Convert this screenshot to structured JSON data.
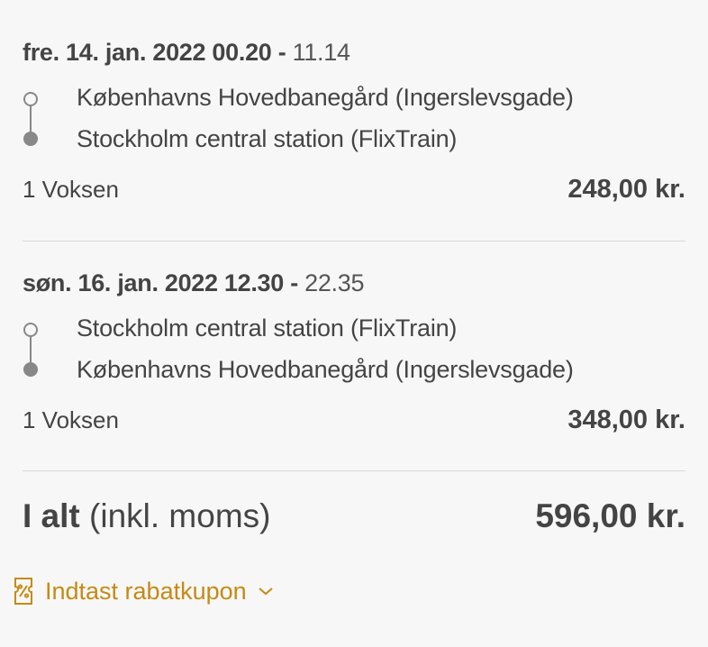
{
  "trips": [
    {
      "departure": "fre. 14. jan. 2022 00.20",
      "separator": " - ",
      "arrival": "11.14",
      "from": "Københavns Hovedbanegård (Ingerslevsgade)",
      "to": "Stockholm central station (FlixTrain)",
      "passengers": "1 Voksen",
      "price": "248,00 kr."
    },
    {
      "departure": "søn. 16. jan. 2022 12.30",
      "separator": " - ",
      "arrival": "22.35",
      "from": "Stockholm central station (FlixTrain)",
      "to": "Københavns Hovedbanegård (Ingerslevsgade)",
      "passengers": "1 Voksen",
      "price": "348,00 kr."
    }
  ],
  "total": {
    "label": "I alt",
    "note": "(inkl. moms)",
    "price": "596,00 kr."
  },
  "coupon": {
    "label": "Indtast rabatkupon",
    "icon": "coupon-icon",
    "chevron": "chevron-down-icon"
  },
  "colors": {
    "accent": "#c68a14",
    "text": "#444444",
    "route_line": "#888888",
    "divider": "#d9d9d9",
    "background": "#f7f7f7"
  }
}
